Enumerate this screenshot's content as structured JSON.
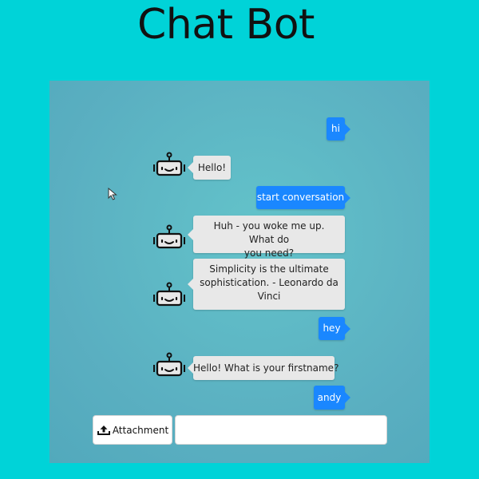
{
  "app": {
    "title": "Chat Bot"
  },
  "colors": {
    "background": "#00d3d8",
    "chat_background": "#5ab6c3",
    "user_bubble": "#1a87ff",
    "bot_bubble": "#e8e8e8"
  },
  "conversation": {
    "messages": [
      {
        "sender": "user",
        "text": "hi"
      },
      {
        "sender": "bot",
        "text": "Hello!"
      },
      {
        "sender": "user",
        "text": "start conversation"
      },
      {
        "sender": "bot",
        "lines": [
          "Huh - you woke me up. What do",
          "you need?"
        ]
      },
      {
        "sender": "bot",
        "lines": [
          "Simplicity is the ultimate",
          "sophistication. - Leonardo da",
          "Vinci"
        ]
      },
      {
        "sender": "user",
        "text": "hey"
      },
      {
        "sender": "bot",
        "text": "Hello! What is your firstname?"
      },
      {
        "sender": "user",
        "text": "andy"
      }
    ]
  },
  "composer": {
    "attachment_label": "Attachment",
    "attachment_icon": "upload-icon",
    "input_value": "",
    "input_placeholder": ""
  },
  "icons": {
    "bot_avatar": "robot-icon",
    "pointer": "mouse-pointer-icon"
  }
}
